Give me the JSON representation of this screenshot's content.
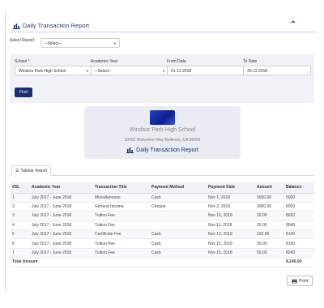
{
  "header": {
    "title": "Daily Transaction Report",
    "collapse_icon": "chevron-up-icon"
  },
  "top_filter": {
    "label": "Select Report",
    "value": "--Select--"
  },
  "filters": {
    "school_label": "School *",
    "school_value": "Windsor Park High School",
    "year_label": "Academic Year",
    "year_value": "--Select--",
    "from_label": "From Date",
    "from_value": "01-11-2018",
    "to_label": "To Date",
    "to_value": "30-11-2018",
    "find_label": "Find"
  },
  "school_card": {
    "name": "Windsor Park High School",
    "address": "10433 Wolverine Way Bellevue, CA 98456",
    "report_title": "Daily Transaction Report"
  },
  "tabs": [
    {
      "label": "Tabular Report",
      "icon": "list-icon"
    }
  ],
  "table": {
    "columns": [
      "#SL",
      "Academic Year",
      "Transaction Title",
      "Payment Method",
      "Payment Date",
      "Amount",
      "Balance"
    ],
    "rows": [
      [
        "1",
        "July 2017 - June 2018",
        "Miscellaneous",
        "Cash",
        "Nov 1, 2018",
        "5000.00",
        "5000"
      ],
      [
        "2",
        "July 2017 - June 2018",
        "General Income",
        "Cheque",
        "Nov 2, 2018",
        "3000.00",
        "8000"
      ],
      [
        "3",
        "July 2017 - June 2018",
        "Tuition Fee",
        "",
        "Nov 10, 2018",
        "20.00",
        "8020"
      ],
      [
        "4",
        "July 2017 - June 2018",
        "Tuition Fee",
        "",
        "Nov 11, 2018",
        "20.00",
        "8040"
      ],
      [
        "5",
        "July 2017 - June 2018",
        "Certificate Fee",
        "Cash",
        "Nov 13, 2018",
        "100.00",
        "8140"
      ],
      [
        "6",
        "July 2017 - June 2018",
        "Tuition Fee",
        "Cash",
        "Nov 15, 2018",
        "50.00",
        "8190"
      ],
      [
        "7",
        "July 2017 - June 2018",
        "Tuition Fee",
        "Cash",
        "Nov 15, 2018",
        "50.00",
        "8240"
      ]
    ],
    "total_label": "Total Amount",
    "total_value": "8,240.00"
  },
  "print_label": "Print"
}
